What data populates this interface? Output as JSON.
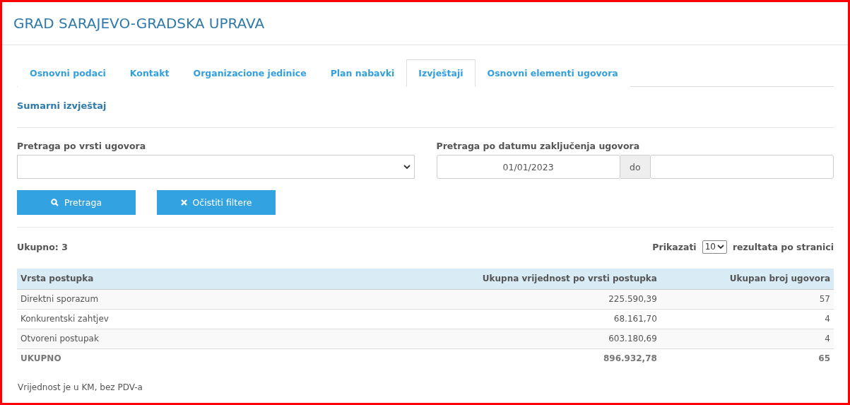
{
  "header": {
    "title": "GRAD SARAJEVO-GRADSKA UPRAVA"
  },
  "tabs": [
    {
      "label": "Osnovni podaci",
      "selected": false
    },
    {
      "label": "Kontakt",
      "selected": false
    },
    {
      "label": "Organizacione jedinice",
      "selected": false
    },
    {
      "label": "Plan nabavki",
      "selected": false
    },
    {
      "label": "Izvještaji",
      "selected": true
    },
    {
      "label": "Osnovni elementi ugovora",
      "selected": false
    }
  ],
  "section_title": "Sumarni izvještaj",
  "filters": {
    "type_label": "Pretraga po vrsti ugovora",
    "date_label": "Pretraga po datumu zaključenja ugovora",
    "date_from": "01/01/2023",
    "date_separator": "do"
  },
  "buttons": [
    {
      "kind": "search",
      "label": "Pretraga"
    },
    {
      "kind": "clear",
      "label": "Očistiti filtere"
    }
  ],
  "total_count": "Ukupno: 3",
  "page_size": {
    "before": "Prikazati",
    "value": "10",
    "after": "rezultata po stranici"
  },
  "table": {
    "columns": [
      "Vrsta postupka",
      "Ukupna vrijednost po vrsti postupka",
      "Ukupan broj ugovora"
    ],
    "rows": [
      [
        "Direktni sporazum",
        "225.590,39",
        "57"
      ],
      [
        "Konkurentski zahtjev",
        "68.161,70",
        "4"
      ],
      [
        "Otvoreni postupak",
        "603.180,69",
        "4"
      ]
    ],
    "total": [
      "UKUPNO",
      "896.932,78",
      "65"
    ]
  },
  "note": "Vrijednost je u KM, bez PDV-a"
}
